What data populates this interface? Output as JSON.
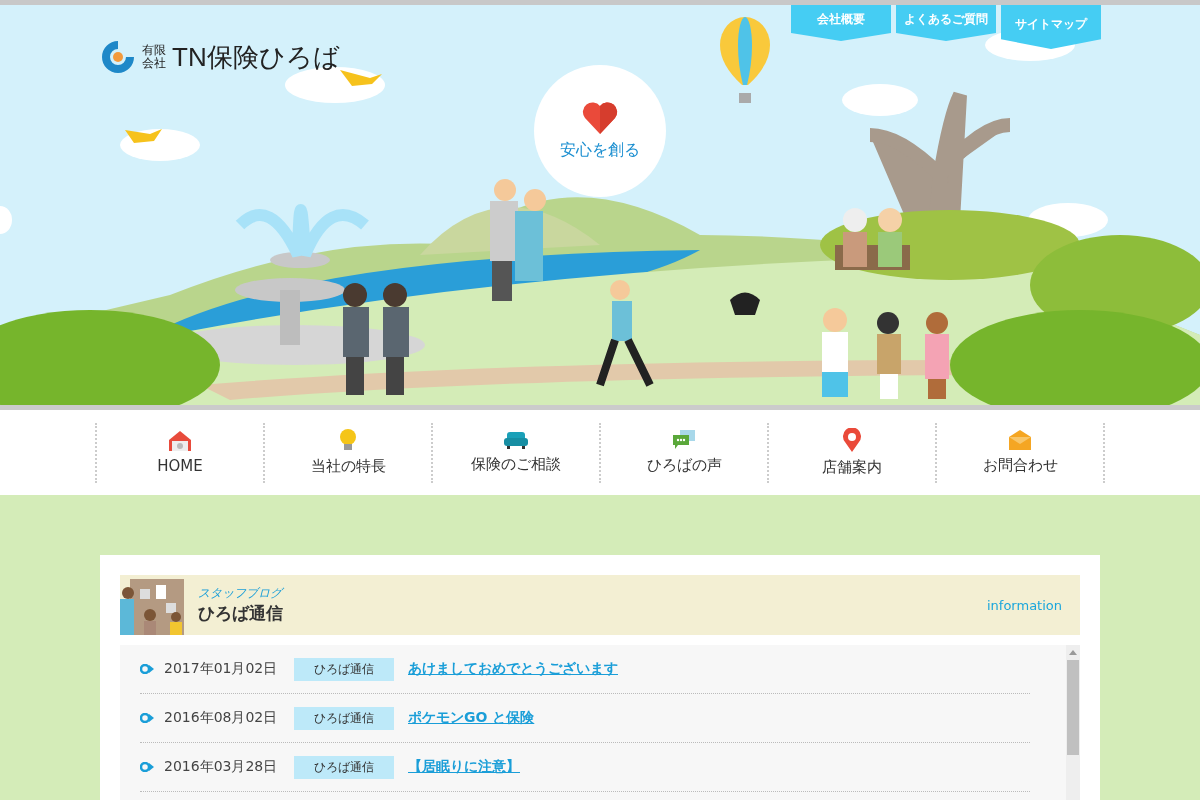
{
  "header": {
    "logo_small_top": "有限",
    "logo_small_bottom": "会社",
    "logo_name": "TN保険ひろば"
  },
  "top_links": [
    {
      "label": "会社概要"
    },
    {
      "label": "よくあるご質問"
    },
    {
      "label": "サイトマップ"
    }
  ],
  "hero": {
    "bubble_text": "安心を創る"
  },
  "nav": [
    {
      "label": "HOME"
    },
    {
      "label": "当社の特長"
    },
    {
      "label": "保険のご相談"
    },
    {
      "label": "ひろばの声"
    },
    {
      "label": "店舗案内"
    },
    {
      "label": "お問合わせ"
    }
  ],
  "blog": {
    "subtitle": "スタッフブログ",
    "title": "ひろば通信",
    "link": "information",
    "posts": [
      {
        "date": "2017年01月02日",
        "category": "ひろば通信",
        "title": "あけましておめでとうございます"
      },
      {
        "date": "2016年08月02日",
        "category": "ひろば通信",
        "title": "ポケモンGO と保険"
      },
      {
        "date": "2016年03月28日",
        "category": "ひろば通信",
        "title": "【居眠りに注意】"
      }
    ]
  }
}
